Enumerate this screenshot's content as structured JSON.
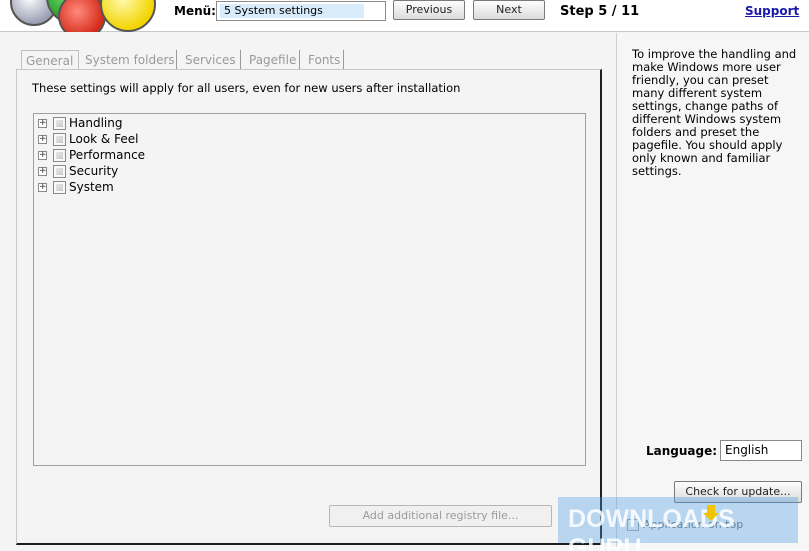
{
  "header": {
    "menu_label": "Menü:",
    "menu_selected": "5 System settings",
    "previous_label": "Previous",
    "next_label": "Next",
    "step_text": "Step 5 / 11",
    "support_label": "Support"
  },
  "tabs": [
    {
      "label": "General",
      "active": true
    },
    {
      "label": "System folders",
      "active": false
    },
    {
      "label": "Services",
      "active": false
    },
    {
      "label": "Pagefile",
      "active": false
    },
    {
      "label": "Fonts",
      "active": false
    }
  ],
  "main": {
    "info_text": "These settings will apply for all users, even for new users after installation",
    "tree_items": [
      {
        "label": "Handling",
        "expander": "+"
      },
      {
        "label": "Look & Feel",
        "expander": "+"
      },
      {
        "label": "Performance",
        "expander": "+"
      },
      {
        "label": "Security",
        "expander": "+"
      },
      {
        "label": "System",
        "expander": "+"
      }
    ],
    "registry_button_label": "Add additional registry file..."
  },
  "sidebar": {
    "help_text": "To improve the handling and make Windows more user friendly, you can preset many different system settings, change paths of different Windows system folders and preset the pagefile. You should apply only known and familiar settings.",
    "language_label": "Language:",
    "language_value": "English",
    "update_button_label": "Check for update...",
    "faded_option_text": "Application on top"
  },
  "watermark": {
    "text": "DOWNLOADS GURU"
  },
  "colors": {
    "link": "#1a1aa8",
    "selection": "#d9ecfb",
    "disabled_text": "#9a9a9a"
  }
}
